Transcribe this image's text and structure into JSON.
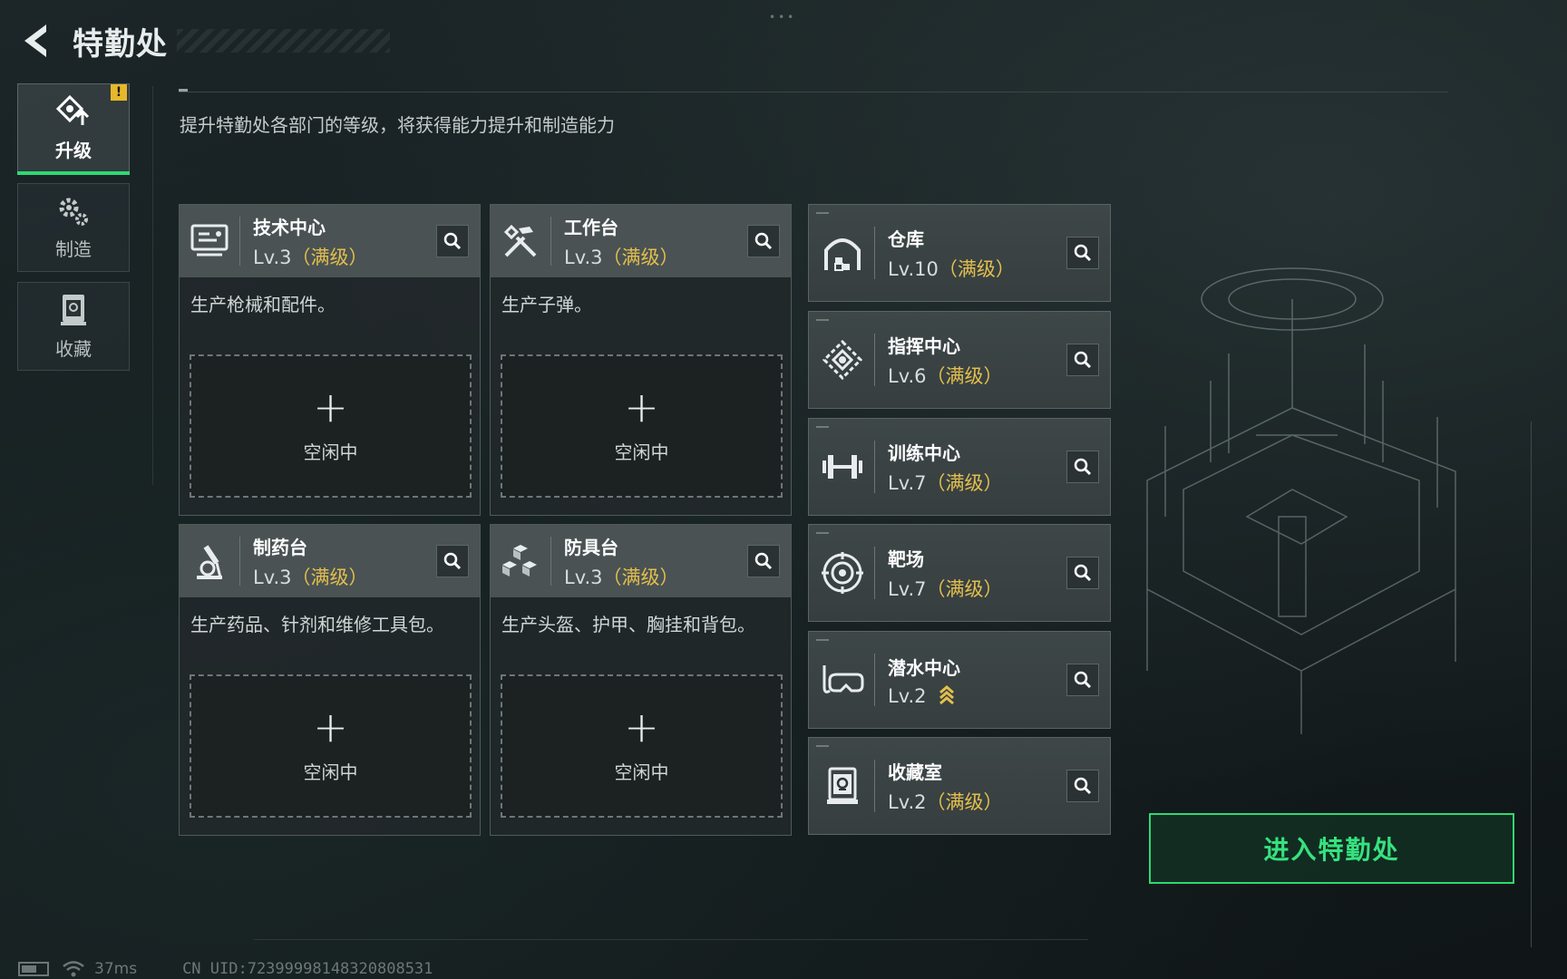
{
  "header": {
    "title": "特勤处"
  },
  "nav": [
    {
      "label": "升级",
      "icon": "upgrade-icon",
      "active": true,
      "badge": "!"
    },
    {
      "label": "制造",
      "icon": "gears-icon",
      "active": false
    },
    {
      "label": "收藏",
      "icon": "collection-icon",
      "active": false
    }
  ],
  "description": "提升特勤处各部门的等级，将获得能力提升和制造能力",
  "cards": [
    {
      "name": "技术中心",
      "level": "Lv.3",
      "max": "（满级）",
      "desc": "生产枪械和配件。",
      "slot": "空闲中",
      "icon": "computer-icon"
    },
    {
      "name": "工作台",
      "level": "Lv.3",
      "max": "（满级）",
      "desc": "生产子弹。",
      "slot": "空闲中",
      "icon": "tools-icon"
    },
    {
      "name": "制药台",
      "level": "Lv.3",
      "max": "（满级）",
      "desc": "生产药品、针剂和维修工具包。",
      "slot": "空闲中",
      "icon": "microscope-icon"
    },
    {
      "name": "防具台",
      "level": "Lv.3",
      "max": "（满级）",
      "desc": "生产头盔、护甲、胸挂和背包。",
      "slot": "空闲中",
      "icon": "armor-blocks-icon"
    }
  ],
  "slot_plus": "+",
  "facilities": [
    {
      "name": "仓库",
      "level": "Lv.10",
      "max": "（满级）",
      "icon": "warehouse-icon"
    },
    {
      "name": "指挥中心",
      "level": "Lv.6",
      "max": "（满级）",
      "icon": "command-icon"
    },
    {
      "name": "训练中心",
      "level": "Lv.7",
      "max": "（满级）",
      "icon": "dumbbell-icon"
    },
    {
      "name": "靶场",
      "level": "Lv.7",
      "max": "（满级）",
      "icon": "target-icon"
    },
    {
      "name": "潜水中心",
      "level": "Lv.2",
      "max": "",
      "upgrade": "upgrade-available-icon",
      "icon": "diving-mask-icon"
    },
    {
      "name": "收藏室",
      "level": "Lv.2",
      "max": "（满级）",
      "icon": "collection-icon"
    }
  ],
  "enter_button": "进入特勤处",
  "status": {
    "ping": "37ms",
    "uid": "CN UID:723999981483208085​31"
  },
  "colors": {
    "accent": "#2fd872",
    "max_level": "#e3bf4c",
    "badge": "#e6b82a"
  }
}
